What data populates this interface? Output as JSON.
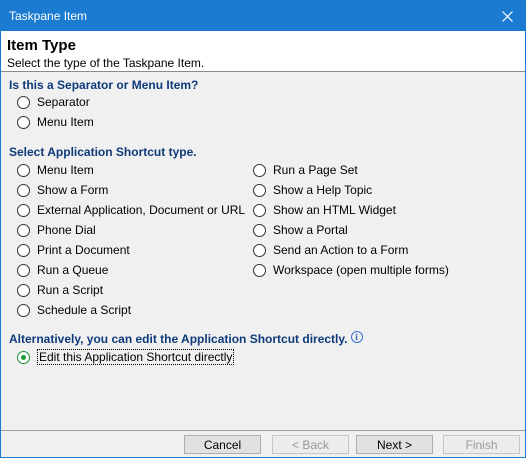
{
  "window": {
    "title": "Taskpane Item"
  },
  "header": {
    "title": "Item Type",
    "subtitle": "Select the type of the Taskpane Item."
  },
  "section1": {
    "title": "Is this a Separator or Menu Item?",
    "options": [
      "Separator",
      "Menu Item"
    ]
  },
  "section2": {
    "title": "Select Application Shortcut type.",
    "left": [
      "Menu Item",
      "Show a Form",
      "External Application, Document or URL",
      "Phone Dial",
      "Print a Document",
      "Run a Queue",
      "Run a Script",
      "Schedule a Script"
    ],
    "right": [
      "Run a Page Set",
      "Show a Help Topic",
      "Show an HTML Widget",
      "Show a Portal",
      "Send an Action to a Form",
      "Workspace (open multiple forms)"
    ]
  },
  "section3": {
    "title": "Alternatively, you can edit the Application Shortcut directly.",
    "option": "Edit this Application Shortcut directly",
    "selected": true
  },
  "footer": {
    "cancel": "Cancel",
    "back": "< Back",
    "next": "Next >",
    "finish": "Finish"
  },
  "icons": {
    "close": "close-icon",
    "info": "info-icon"
  }
}
